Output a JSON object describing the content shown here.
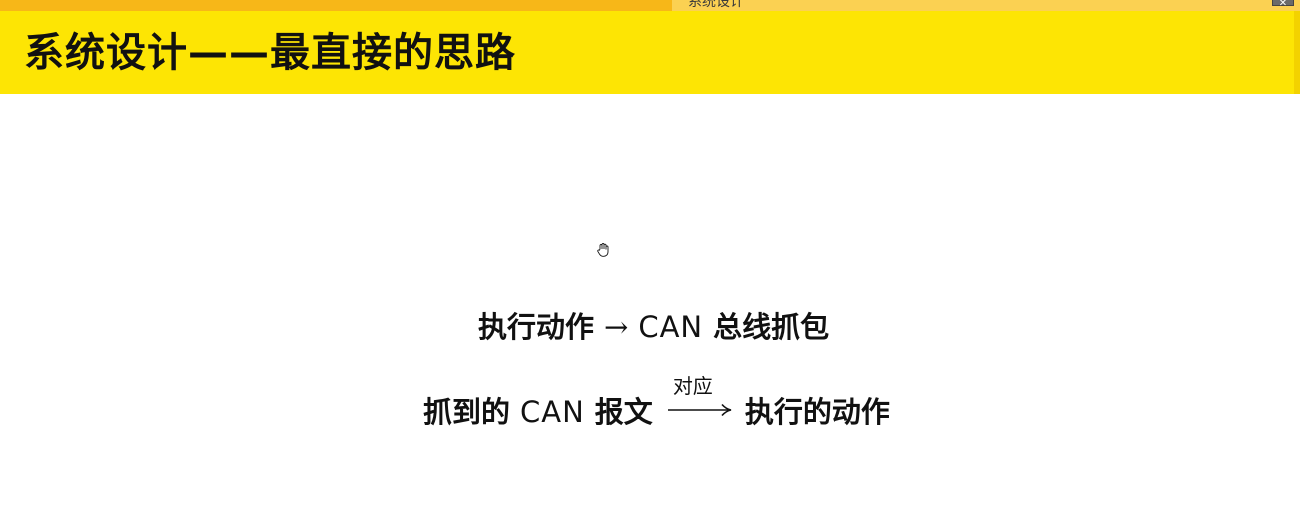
{
  "viewer": {
    "tab_label": "系统设计",
    "close_label": "✕"
  },
  "slide": {
    "title": "系统设计——最直接的思路",
    "line1": {
      "left": "执行动作",
      "arrow": "→",
      "right_latin": "CAN",
      "right_cjk": "总线抓包"
    },
    "line2": {
      "left_cjk": "抓到的",
      "left_latin": "CAN",
      "left_cjk2": "报文",
      "arrow_label": "对应",
      "right": "执行的动作"
    }
  },
  "colors": {
    "title_band": "#fde504",
    "strip_left": "#f7b718",
    "strip_right": "#fbd152",
    "text": "#111111"
  },
  "icons": {
    "cursor": "hand-cursor-icon",
    "arrow": "right-arrow-icon",
    "close": "close-icon"
  }
}
